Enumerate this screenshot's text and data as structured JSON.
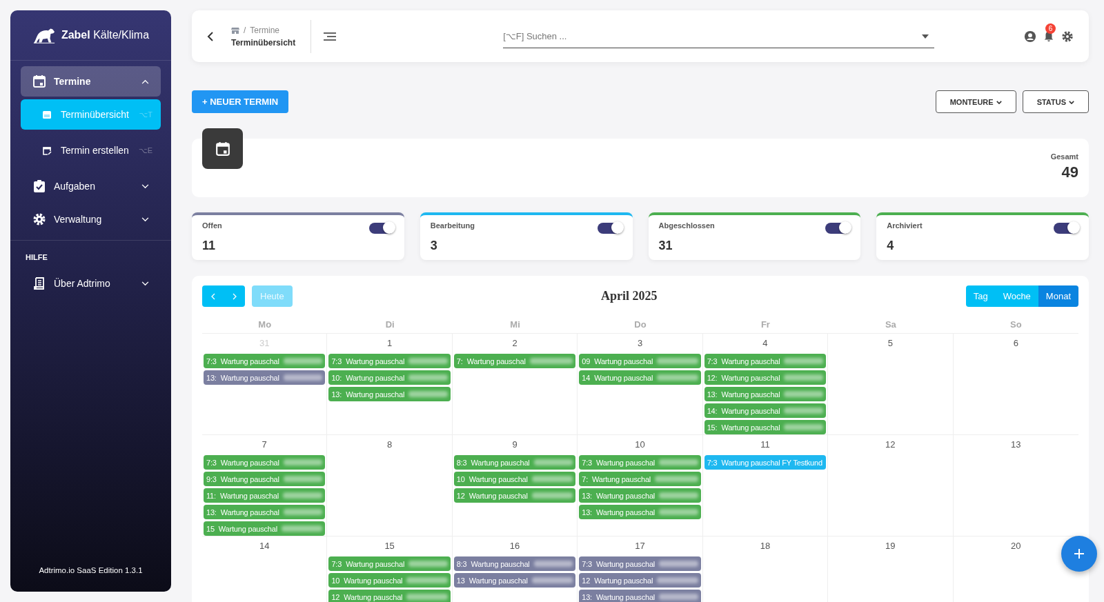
{
  "sidebar": {
    "brand_bold": "Zabel",
    "brand_rest": "Kälte/Klima",
    "items": [
      {
        "label": "Termine",
        "expanded": true,
        "children": [
          {
            "label": "Terminübersicht",
            "shortcut": "⌥T",
            "selected": true
          },
          {
            "label": "Termin erstellen",
            "shortcut": "⌥E",
            "selected": false
          }
        ]
      },
      {
        "label": "Aufgaben",
        "expanded": false
      },
      {
        "label": "Verwaltung",
        "expanded": false
      }
    ],
    "section": "HILFE",
    "help_items": [
      {
        "label": "Über Adtrimo",
        "expanded": false
      }
    ],
    "footer": "Adtrimo.io SaaS Edition 1.3.1"
  },
  "header": {
    "breadcrumb_separator": "/",
    "breadcrumb_parent": "Termine",
    "breadcrumb_current": "Terminübersicht",
    "search": {
      "placeholder": "[⌥F] Suchen ..."
    },
    "notification_count": "6"
  },
  "new_button": "+ NEUER TERMIN",
  "filters": [
    "MONTEURE",
    "STATUS"
  ],
  "summary": {
    "label": "Gesamt",
    "value": "49"
  },
  "stats": [
    {
      "label": "Offen",
      "value": "11",
      "color": "#7b7fa0",
      "on": true
    },
    {
      "label": "Bearbeitung",
      "value": "3",
      "color": "#1eb8f0",
      "on": true
    },
    {
      "label": "Abgeschlossen",
      "value": "31",
      "color": "#4caf50",
      "on": true
    },
    {
      "label": "Archiviert",
      "value": "4",
      "color": "#4caf50",
      "on": true
    }
  ],
  "calendar": {
    "title": "April 2025",
    "today": "Heute",
    "views": [
      {
        "label": "Tag",
        "selected": false
      },
      {
        "label": "Woche",
        "selected": false
      },
      {
        "label": "Monat",
        "selected": true
      }
    ],
    "weekdays": [
      "Mo",
      "Di",
      "Mi",
      "Do",
      "Fr",
      "Sa",
      "So"
    ],
    "weeks": [
      {
        "days": [
          {
            "date": "31",
            "muted": true,
            "events": [
              {
                "time": "7:3",
                "title": "Wartung pauschal",
                "color": "#4caf50",
                "blurred": true
              },
              {
                "time": "13:",
                "title": "Wartung pauschal",
                "color": "#7b7fa0",
                "blurred": true
              }
            ]
          },
          {
            "date": "1",
            "muted": false,
            "events": [
              {
                "time": "7:3",
                "title": "Wartung pauschal",
                "color": "#4caf50",
                "blurred": true
              },
              {
                "time": "10:",
                "title": "Wartung pauschal",
                "color": "#4caf50",
                "blurred": true
              },
              {
                "time": "13:",
                "title": "Wartung pauschal",
                "color": "#4caf50",
                "blurred": true
              }
            ]
          },
          {
            "date": "2",
            "muted": false,
            "events": [
              {
                "time": "7:",
                "title": "Wartung pauschal",
                "color": "#4caf50",
                "blurred": true
              }
            ]
          },
          {
            "date": "3",
            "muted": false,
            "events": [
              {
                "time": "09",
                "title": "Wartung pauschal",
                "color": "#4caf50",
                "blurred": true
              },
              {
                "time": "14",
                "title": "Wartung pauschal",
                "color": "#4caf50",
                "blurred": true
              }
            ]
          },
          {
            "date": "4",
            "muted": false,
            "events": [
              {
                "time": "7:3",
                "title": "Wartung pauschal",
                "color": "#4caf50",
                "blurred": true
              },
              {
                "time": "12:",
                "title": "Wartung pauschal",
                "color": "#4caf50",
                "blurred": true
              },
              {
                "time": "13:",
                "title": "Wartung pauschal",
                "color": "#4caf50",
                "blurred": true
              },
              {
                "time": "14:",
                "title": "Wartung pauschal",
                "color": "#4caf50",
                "blurred": true
              },
              {
                "time": "15:",
                "title": "Wartung pauschal",
                "color": "#4caf50",
                "blurred": true
              }
            ]
          },
          {
            "date": "5",
            "muted": false
          },
          {
            "date": "6",
            "muted": false
          }
        ]
      },
      {
        "days": [
          {
            "date": "7",
            "muted": false,
            "events": [
              {
                "time": "7:3",
                "title": "Wartung pauschal",
                "color": "#4caf50",
                "blurred": true
              },
              {
                "time": "9:3",
                "title": "Wartung pauschal",
                "color": "#4caf50",
                "blurred": true
              },
              {
                "time": "11:",
                "title": "Wartung pauschal",
                "color": "#4caf50",
                "blurred": true
              },
              {
                "time": "13:",
                "title": "Wartung pauschal",
                "color": "#4caf50",
                "blurred": true
              },
              {
                "time": "15",
                "title": "Wartung pauschal",
                "color": "#4caf50",
                "blurred": true
              }
            ]
          },
          {
            "date": "8",
            "muted": false
          },
          {
            "date": "9",
            "muted": false,
            "events": [
              {
                "time": "8:3",
                "title": "Wartung pauschal",
                "color": "#4caf50",
                "blurred": true
              },
              {
                "time": "10",
                "title": "Wartung pauschal",
                "color": "#4caf50",
                "blurred": true
              },
              {
                "time": "12",
                "title": "Wartung pauschal",
                "color": "#4caf50",
                "blurred": true
              }
            ]
          },
          {
            "date": "10",
            "muted": false,
            "events": [
              {
                "time": "7:3",
                "title": "Wartung pauschal",
                "color": "#4caf50",
                "blurred": true
              },
              {
                "time": "7:",
                "title": "Wartung pauschal",
                "color": "#4caf50",
                "blurred": true
              },
              {
                "time": "13:",
                "title": "Wartung pauschal",
                "color": "#4caf50",
                "blurred": true
              },
              {
                "time": "13:",
                "title": "Wartung pauschal",
                "color": "#4caf50",
                "blurred": true
              }
            ]
          },
          {
            "date": "11",
            "muted": false,
            "events": [
              {
                "time": "7:3",
                "title": "Wartung pauschal FY Testkund",
                "color": "#1eb8f0",
                "blurred": false
              }
            ]
          },
          {
            "date": "12",
            "muted": false
          },
          {
            "date": "13",
            "muted": false
          }
        ]
      },
      {
        "days": [
          {
            "date": "14",
            "muted": false
          },
          {
            "date": "15",
            "muted": false,
            "events": [
              {
                "time": "7:3",
                "title": "Wartung pauschal",
                "color": "#4caf50",
                "blurred": true
              },
              {
                "time": "10",
                "title": "Wartung pauschal",
                "color": "#4caf50",
                "blurred": true
              },
              {
                "time": "12",
                "title": "Wartung pauschal",
                "color": "#4caf50",
                "blurred": true
              }
            ]
          },
          {
            "date": "16",
            "muted": false,
            "events": [
              {
                "time": "8:3",
                "title": "Wartung pauschal",
                "color": "#7b7fa0",
                "blurred": true
              },
              {
                "time": "13",
                "title": "Wartung pauschal",
                "color": "#7b7fa0",
                "blurred": true
              }
            ]
          },
          {
            "date": "17",
            "muted": false,
            "events": [
              {
                "time": "7:3",
                "title": "Wartung pauschal",
                "color": "#7b7fa0",
                "blurred": true
              },
              {
                "time": "12",
                "title": "Wartung pauschal",
                "color": "#7b7fa0",
                "blurred": true
              },
              {
                "time": "13:",
                "title": "Wartung pauschal",
                "color": "#7b7fa0",
                "blurred": true
              }
            ]
          },
          {
            "date": "18",
            "muted": false
          },
          {
            "date": "19",
            "muted": false
          },
          {
            "date": "20",
            "muted": false
          }
        ]
      }
    ]
  }
}
